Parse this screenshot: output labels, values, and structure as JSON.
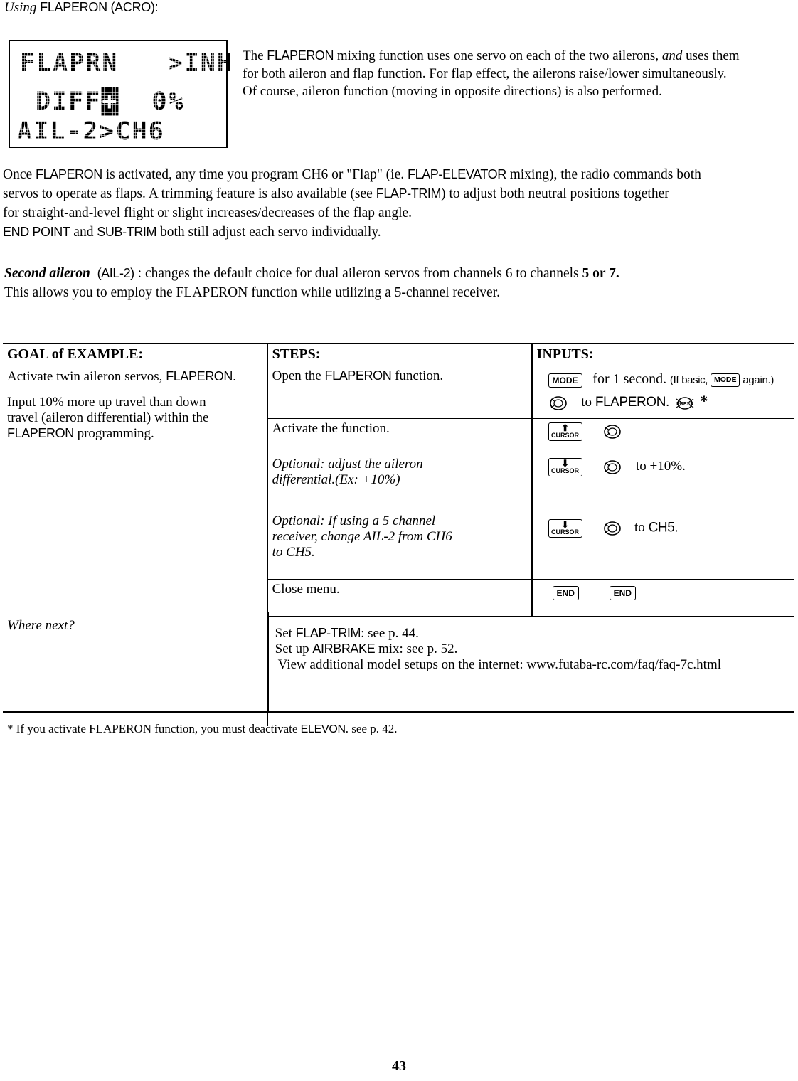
{
  "heading": {
    "italic_word": "Using",
    "cond_text": "FLAPERON (ACRO):"
  },
  "lcd": {
    "line1_a": "FLAPRN",
    "line1_b": ">INH",
    "line2_a": "DIFF",
    "line2_b": "+",
    "line2_c": "0%",
    "line3": "AIL-2>CH6"
  },
  "intro_right": {
    "seg1": "The ",
    "cond1": "FLAPERON",
    "seg2": " mixing function uses one servo on each of the two ailerons, ",
    "ital1": "and",
    "seg3": " uses them",
    "line2": "for both aileron and flap function. For flap effect, the ailerons raise/lower simultaneously.",
    "line3": "Of course, aileron function (moving in opposite directions) is also performed."
  },
  "para1": {
    "l1_a": "Once ",
    "l1_cond1": "FLAPERON",
    "l1_b": " is activated, any time you program CH6 or \"Flap\" (ie. ",
    "l1_cond2": "FLAP-ELEVATOR",
    "l1_c": " mixing), the radio commands both",
    "l2_a": "servos to operate as flaps.  A trimming feature is also available (see ",
    "l2_cond": "FLAP-TRIM",
    "l2_b": ") to adjust both neutral positions together",
    "l3": "for straight-and-level flight or slight increases/decreases of the flap angle.",
    "l4_cond1": "END POINT",
    "l4_a": " and ",
    "l4_cond2": "SUB-TRIM",
    "l4_b": " both still adjust each servo individually."
  },
  "para2": {
    "bold_italic": "Second aileron",
    "cond1": "(AIL-2)",
    "body": " : changes the default choice for dual aileron servos from channels  6  to channels ",
    "bold_tail": "5 or 7.",
    "line2": "This allows you to employ the FLAPERON function while utilizing a 5-channel receiver."
  },
  "table": {
    "headers": {
      "goal": "GOAL of EXAMPLE:",
      "steps": "STEPS:",
      "inputs": "INPUTS:"
    },
    "goal": {
      "l1_a": "Activate twin aileron servos, ",
      "l1_cond": "FLAPERON.",
      "l2": "Input 10% more up travel than down",
      "l3": "travel (aileron differential) within the",
      "l4_cond": "FLAPERON",
      "l4_b": " programming."
    },
    "rows": [
      {
        "step_a": "Open the ",
        "step_cond": "FLAPERON",
        "step_b": " function.",
        "input_key1": "MODE",
        "input_text1": "for 1 second.",
        "input_paren_a": "(If ",
        "input_paren_cond": "basic",
        "input_paren_b": ", ",
        "input_key2": "MODE",
        "input_paren_c": " again.)",
        "input_text2_a": "to ",
        "input_text2_cond": "FLAPERON.",
        "input_press": "PRESS",
        "input_star": "*"
      },
      {
        "step": "Activate the function.",
        "cursor_label": "CURSOR",
        "cursor_dir": "up"
      },
      {
        "step_l1": "Optional: adjust the aileron",
        "step_l2": "differential.(Ex: +10%)",
        "cursor_label": "CURSOR",
        "cursor_dir": "down",
        "input_text": "to +10%."
      },
      {
        "step_l1": "Optional: If using a 5 channel",
        "step_l2": "receiver, change AIL-2 from CH6",
        "step_l3": "to CH5.",
        "cursor_label": "CURSOR",
        "cursor_dir": "down",
        "input_text_a": "to ",
        "input_text_cond": "CH5."
      },
      {
        "step": "Close menu.",
        "key1": "END",
        "key2": "END"
      }
    ],
    "where_next": {
      "label": "Where next?",
      "l1_a": "Set ",
      "l1_cond": "FLAP-TRIM",
      "l1_b": ": see p. 44.",
      "l2_a": "Set up ",
      "l2_cond": "AIRBRAKE",
      "l2_b": " mix: see p. 52.",
      "l3": "View additional model setups on the internet:  www.futaba-rc.com/faq/faq-7c.html"
    }
  },
  "footnote": {
    "a": "* If you activate FLAPERON function, you must deactivate ",
    "cond": "ELEVON",
    "b": ". see p. 42."
  },
  "page_number": "43"
}
